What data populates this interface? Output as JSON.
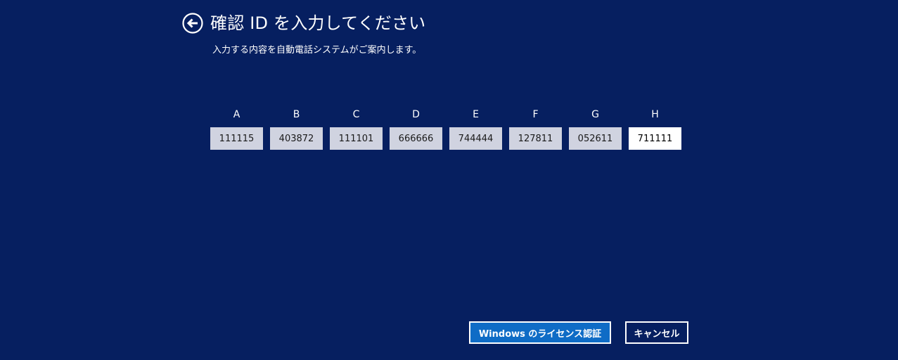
{
  "header": {
    "title": "確認 ID を入力してください",
    "subtitle": "入力する内容を自動電話システムがご案内します。"
  },
  "icons": {
    "back": "back-arrow-icon"
  },
  "groups": [
    {
      "label": "A",
      "value": "111115"
    },
    {
      "label": "B",
      "value": "403872"
    },
    {
      "label": "C",
      "value": "111101"
    },
    {
      "label": "D",
      "value": "666666"
    },
    {
      "label": "E",
      "value": "744444"
    },
    {
      "label": "F",
      "value": "127811"
    },
    {
      "label": "G",
      "value": "052611"
    },
    {
      "label": "H",
      "value": "711111"
    }
  ],
  "buttons": {
    "activate": "Windows のライセンス認証",
    "cancel": "キャンセル"
  },
  "colors": {
    "background": "#061f60",
    "primary_button": "#0f6cc6",
    "input_filled": "#d0d3e0",
    "input_active": "#ffffff"
  }
}
